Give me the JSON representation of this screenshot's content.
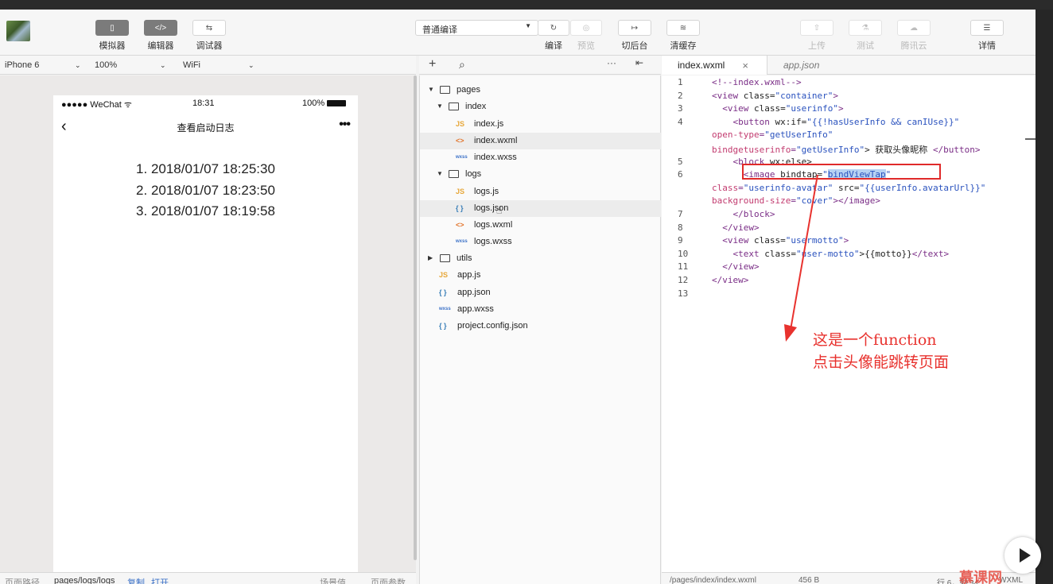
{
  "toolbar": {
    "buttons": [
      {
        "label": "模拟器",
        "icon": "phone-icon",
        "glyph": "▯"
      },
      {
        "label": "编辑器",
        "icon": "code-icon",
        "glyph": "</>"
      },
      {
        "label": "调试器",
        "icon": "debug-icon",
        "glyph": "⇆"
      }
    ],
    "compile_mode": "普通编译",
    "actions": [
      {
        "label": "编译",
        "glyph": "↻",
        "enabled": true
      },
      {
        "label": "预览",
        "glyph": "◎",
        "enabled": false
      },
      {
        "label": "切后台",
        "glyph": "↦",
        "enabled": true
      },
      {
        "label": "清缓存",
        "glyph": "≋",
        "enabled": true
      }
    ],
    "right_actions": [
      {
        "label": "上传",
        "glyph": "⇧",
        "enabled": false
      },
      {
        "label": "测试",
        "glyph": "⚗",
        "enabled": false
      },
      {
        "label": "腾讯云",
        "glyph": "☁",
        "enabled": false
      },
      {
        "label": "详情",
        "glyph": "☰",
        "enabled": true
      }
    ]
  },
  "simulator": {
    "device": "iPhone 6",
    "zoom": "100%",
    "network": "WiFi",
    "status_carrier": "●●●●● WeChat",
    "status_time": "18:31",
    "status_battery": "100%",
    "page_title": "查看启动日志",
    "logs": [
      "1. 2018/01/07 18:25:30",
      "2. 2018/01/07 18:23:50",
      "3. 2018/01/07 18:19:58"
    ],
    "footer": {
      "path_label": "页面路径",
      "path": "pages/logs/logs",
      "copy": "复制",
      "open": "打开",
      "scene": "场景值",
      "params": "页面参数"
    }
  },
  "files": {
    "tree": [
      {
        "type": "folder",
        "label": "pages",
        "depth": 0,
        "open": true
      },
      {
        "type": "folder",
        "label": "index",
        "depth": 1,
        "open": true
      },
      {
        "type": "js",
        "label": "index.js",
        "depth": 2
      },
      {
        "type": "wxml",
        "label": "index.wxml",
        "depth": 2,
        "active": true
      },
      {
        "type": "wxss",
        "label": "index.wxss",
        "depth": 2
      },
      {
        "type": "folder",
        "label": "logs",
        "depth": 1,
        "open": true
      },
      {
        "type": "js",
        "label": "logs.js",
        "depth": 2
      },
      {
        "type": "json",
        "label": "logs.json",
        "depth": 2,
        "hover": true
      },
      {
        "type": "wxml",
        "label": "logs.wxml",
        "depth": 2
      },
      {
        "type": "wxss",
        "label": "logs.wxss",
        "depth": 2
      },
      {
        "type": "folder",
        "label": "utils",
        "depth": 0,
        "open": false
      },
      {
        "type": "js",
        "label": "app.js",
        "depth": 1
      },
      {
        "type": "json",
        "label": "app.json",
        "depth": 1
      },
      {
        "type": "wxss",
        "label": "app.wxss",
        "depth": 1
      },
      {
        "type": "json",
        "label": "project.config.json",
        "depth": 1
      }
    ]
  },
  "editor": {
    "tabs": [
      {
        "label": "index.wxml",
        "active": true
      },
      {
        "label": "app.json",
        "active": false
      }
    ],
    "lines": [
      {
        "n": "1",
        "text": "<!--index.wxml-->"
      },
      {
        "n": "2",
        "text": "<view class=\"container\">"
      },
      {
        "n": "3",
        "text": "  <view class=\"userinfo\">"
      },
      {
        "n": "4",
        "text": "    <button wx:if=\"{{!hasUserInfo && canIUse}}\""
      },
      {
        "n": "",
        "text": "open-type=\"getUserInfo\""
      },
      {
        "n": "",
        "text": "bindgetuserinfo=\"getUserInfo\"> 获取头像昵称 </button>"
      },
      {
        "n": "5",
        "text": "    <block wx:else>"
      },
      {
        "n": "6",
        "text": "      <image bindtap=\"bindViewTap\""
      },
      {
        "n": "",
        "text": "class=\"userinfo-avatar\" src=\"{{userInfo.avatarUrl}}\""
      },
      {
        "n": "",
        "text": "background-size=\"cover\"></image>"
      },
      {
        "n": "7",
        "text": "    </block>"
      },
      {
        "n": "8",
        "text": "  </view>"
      },
      {
        "n": "9",
        "text": "  <view class=\"usermotto\">"
      },
      {
        "n": "10",
        "text": "    <text class=\"user-motto\">{{motto}}</text>"
      },
      {
        "n": "11",
        "text": "  </view>"
      },
      {
        "n": "12",
        "text": "</view>"
      },
      {
        "n": "13",
        "text": ""
      }
    ],
    "selected_text": "bindViewTap",
    "annotation_lines": [
      "这是一个function",
      "点击头像能跳转页面"
    ],
    "footer": {
      "path": "/pages/index/index.wxml",
      "size": "456 B",
      "position": "行 6，列 34",
      "lang": "WXML"
    }
  },
  "watermark": "慕课网",
  "colors": {
    "annotation_red": "#e8322e",
    "selection_blue": "#b6d2f3",
    "toolbar_dark_button": "#7b7b7b"
  }
}
